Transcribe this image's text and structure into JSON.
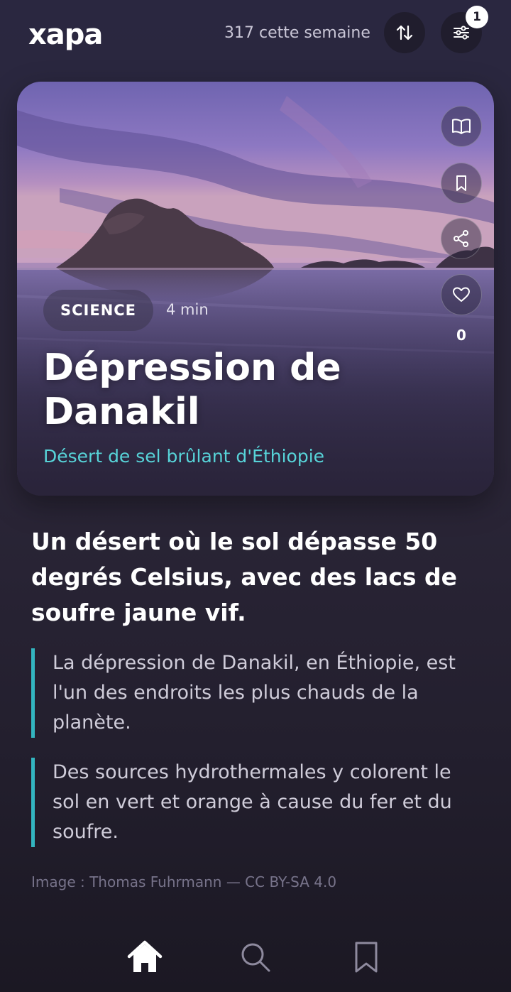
{
  "header": {
    "logo": "xapa",
    "weekly_count": "317 cette semaine",
    "filter_badge": "1",
    "icons": {
      "sort": "sort-arrows-icon",
      "filter": "sliders-icon"
    }
  },
  "card": {
    "category": "SCIENCE",
    "read_time": "4 min",
    "title": "Dépression de Danakil",
    "subtitle": "Désert de sel brûlant d'Éthiopie",
    "like_count": "0",
    "side_icons": [
      "book-open-icon",
      "bookmark-icon",
      "share-icon",
      "heart-icon"
    ]
  },
  "article": {
    "lead": "Un désert où le sol dépasse 50 degrés Celsius, avec des lacs de soufre jaune vif.",
    "quotes": [
      "La dépression de Danakil, en Éthiopie, est l'un des endroits les plus chauds de la planète.",
      "Des sources hydrothermales y colorent le sol en vert et orange à cause du fer et du soufre."
    ],
    "credit": "Image : Thomas Fuhrmann — CC BY-SA 4.0"
  },
  "bottom_nav": {
    "items": [
      "home-icon",
      "search-icon",
      "bookmark-icon"
    ],
    "active": "home-icon"
  },
  "colors": {
    "accent": "#33b5c0",
    "subtitle": "#57d3d8",
    "background": "#2a2740"
  }
}
